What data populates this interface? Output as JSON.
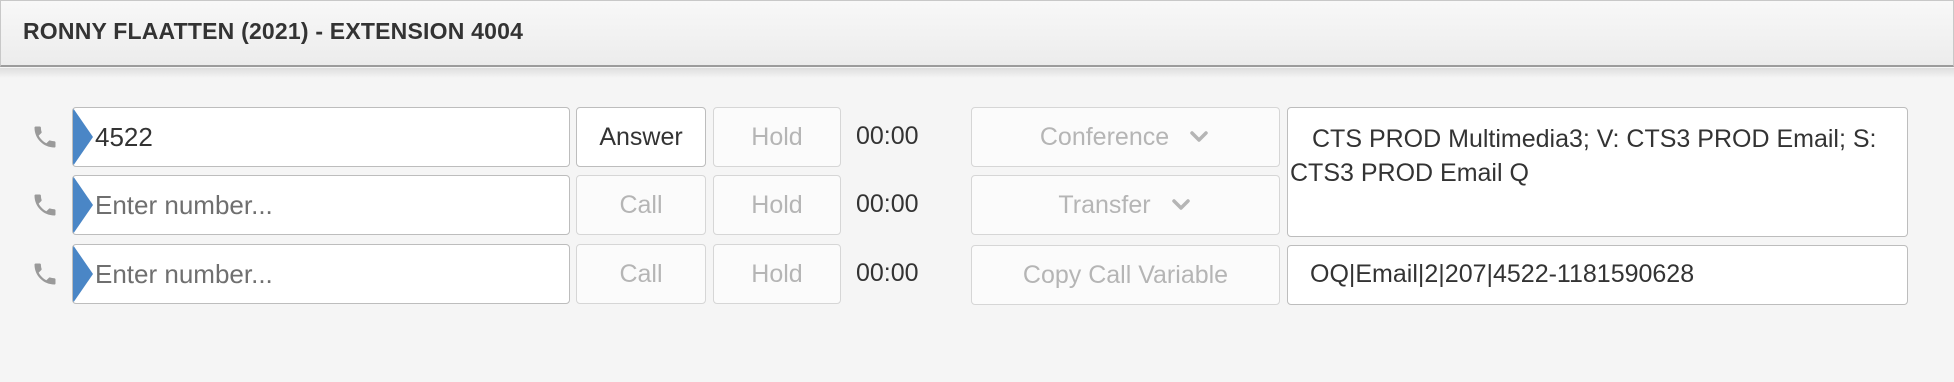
{
  "header": {
    "title": "RONNY FLAATTEN (2021) - EXTENSION 4004"
  },
  "lines": [
    {
      "number_value": "4522",
      "number_placeholder": "Enter number...",
      "primary_label": "Answer",
      "hold_label": "Hold",
      "timer": "00:00"
    },
    {
      "number_value": "",
      "number_placeholder": "Enter number...",
      "primary_label": "Call",
      "hold_label": "Hold",
      "timer": "00:00"
    },
    {
      "number_value": "",
      "number_placeholder": "Enter number...",
      "primary_label": "Call",
      "hold_label": "Hold",
      "timer": "00:00"
    }
  ],
  "actions": {
    "conference_label": "Conference",
    "transfer_label": "Transfer",
    "copy_call_variable_label": "Copy Call Variable"
  },
  "call_info": {
    "queue_text": "CTS PROD Multimedia3; V: CTS3 PROD Email; S: CTS3 PROD Email Q",
    "call_variable": "OQ|Email|2|207|4522-1181590628"
  },
  "icons": {
    "phone": "phone-icon",
    "chevron": "chevron-down-icon"
  },
  "colors": {
    "accent_marker": "#4a86c6",
    "disabled_text": "#b5b5b5",
    "text": "#333333"
  }
}
